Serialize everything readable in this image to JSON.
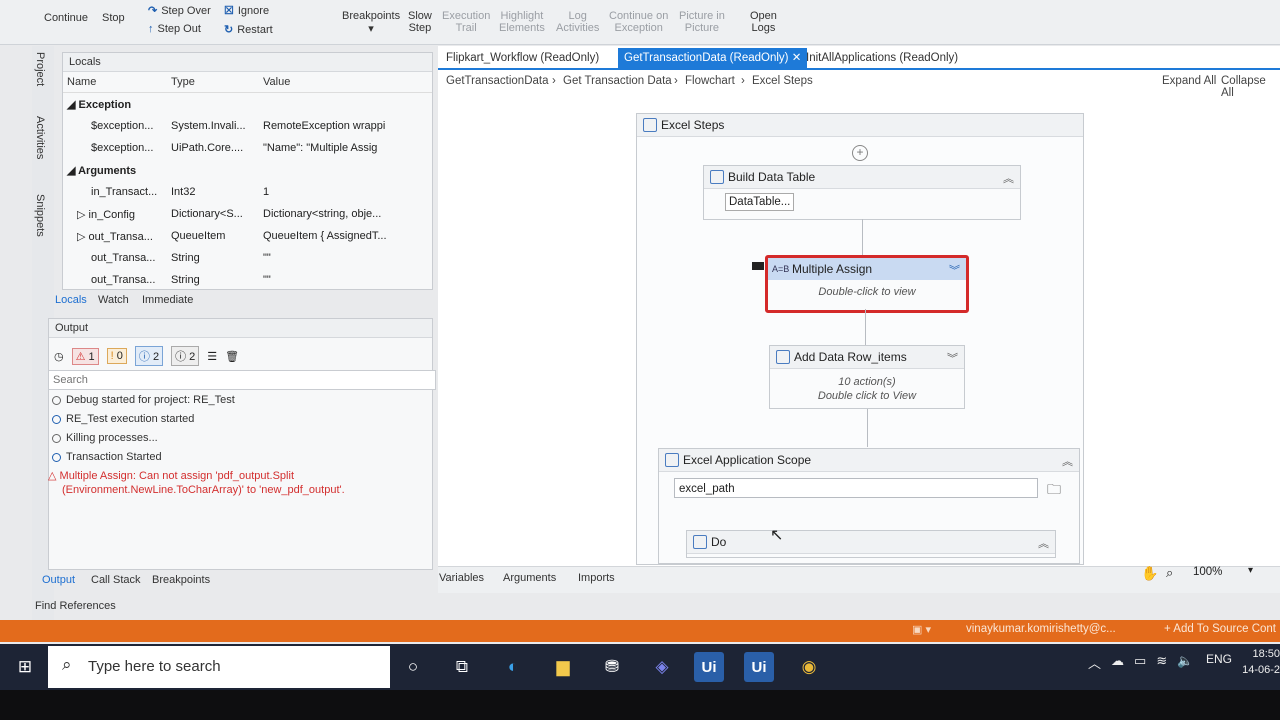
{
  "ribbon": {
    "continue": "Continue",
    "stop": "Stop",
    "step_over": "Step Over",
    "step_out": "Step Out",
    "ignore": "Ignore",
    "restart": "Restart",
    "breakpoints": "Breakpoints",
    "slow_step_1": "Slow",
    "slow_step_2": "Step",
    "exec_trail_1": "Execution",
    "exec_trail_2": "Trail",
    "highlight_1": "Highlight",
    "highlight_2": "Elements",
    "log_1": "Log",
    "log_2": "Activities",
    "cont_exc_1": "Continue on",
    "cont_exc_2": "Exception",
    "pip_1": "Picture in",
    "pip_2": "Picture",
    "open_logs_1": "Open",
    "open_logs_2": "Logs"
  },
  "side_tabs": [
    "Project",
    "Activities",
    "Snippets"
  ],
  "locals": {
    "title": "Locals",
    "col_name": "Name",
    "col_type": "Type",
    "col_value": "Value",
    "sections": {
      "exception": "Exception",
      "arguments": "Arguments"
    },
    "rows": [
      {
        "name": "$exception...",
        "type": "System.Invali...",
        "value": "RemoteException wrappi"
      },
      {
        "name": "$exception...",
        "type": "UiPath.Core....",
        "value": "\"Name\": \"Multiple Assig"
      },
      {
        "name": "in_Transact...",
        "type": "Int32",
        "value": "1"
      },
      {
        "name": "in_Config",
        "type": "Dictionary<S...",
        "value": "Dictionary<string, obje..."
      },
      {
        "name": "out_Transa...",
        "type": "QueueItem",
        "value": "QueueItem { AssignedT..."
      },
      {
        "name": "out_Transa...",
        "type": "String",
        "value": "\"\""
      },
      {
        "name": "out_Transa...",
        "type": "String",
        "value": "\"\""
      }
    ],
    "tabs": [
      "Locals",
      "Watch",
      "Immediate"
    ]
  },
  "output": {
    "title": "Output",
    "counts": [
      "1",
      "0",
      "2",
      "2"
    ],
    "search_placeholder": "Search",
    "lines": [
      "Debug started for project: RE_Test",
      "RE_Test execution started",
      "Killing processes...",
      "Transaction Started"
    ],
    "error_line1": "Multiple Assign: Can not assign 'pdf_output.Split",
    "error_line2": "(Environment.NewLine.ToCharArray)' to 'new_pdf_output'.",
    "tabs": [
      "Output",
      "Call Stack",
      "Breakpoints"
    ],
    "find_references": "Find References"
  },
  "designer": {
    "tabs": [
      "Flipkart_Workflow (ReadOnly)",
      "GetTransactionData (ReadOnly)",
      "InitAllApplications (ReadOnly)"
    ],
    "breadcrumb": [
      "GetTransactionData",
      "Get Transaction Data",
      "Flowchart",
      "Excel Steps"
    ],
    "expand_all": "Expand All",
    "collapse_all": "Collapse All",
    "excel_steps": "Excel Steps",
    "build_dt": "Build Data Table",
    "build_dt_btn": "DataTable...",
    "multi_assign": "Multiple Assign",
    "multi_assign_hint": "Double-click to view",
    "add_row": "Add Data Row_items",
    "add_row_count": "10 action(s)",
    "add_row_hint": "Double click to View",
    "excel_scope": "Excel Application Scope",
    "excel_path": "excel_path",
    "do": "Do",
    "bottom_tabs": [
      "Variables",
      "Arguments",
      "Imports"
    ],
    "zoom": "100%"
  },
  "statusbar": {
    "user": "vinaykumar.komirishetty@c...",
    "source_control": "Add To Source Cont"
  },
  "taskbar": {
    "search_placeholder": "Type here to search",
    "lang": "ENG",
    "time": "18:50",
    "date": "14-06-2"
  },
  "colors": {
    "accent": "#1e7ad8",
    "status_bar": "#e36b1c",
    "error_red": "#d32f2f",
    "taskbar": "#1d2435"
  }
}
